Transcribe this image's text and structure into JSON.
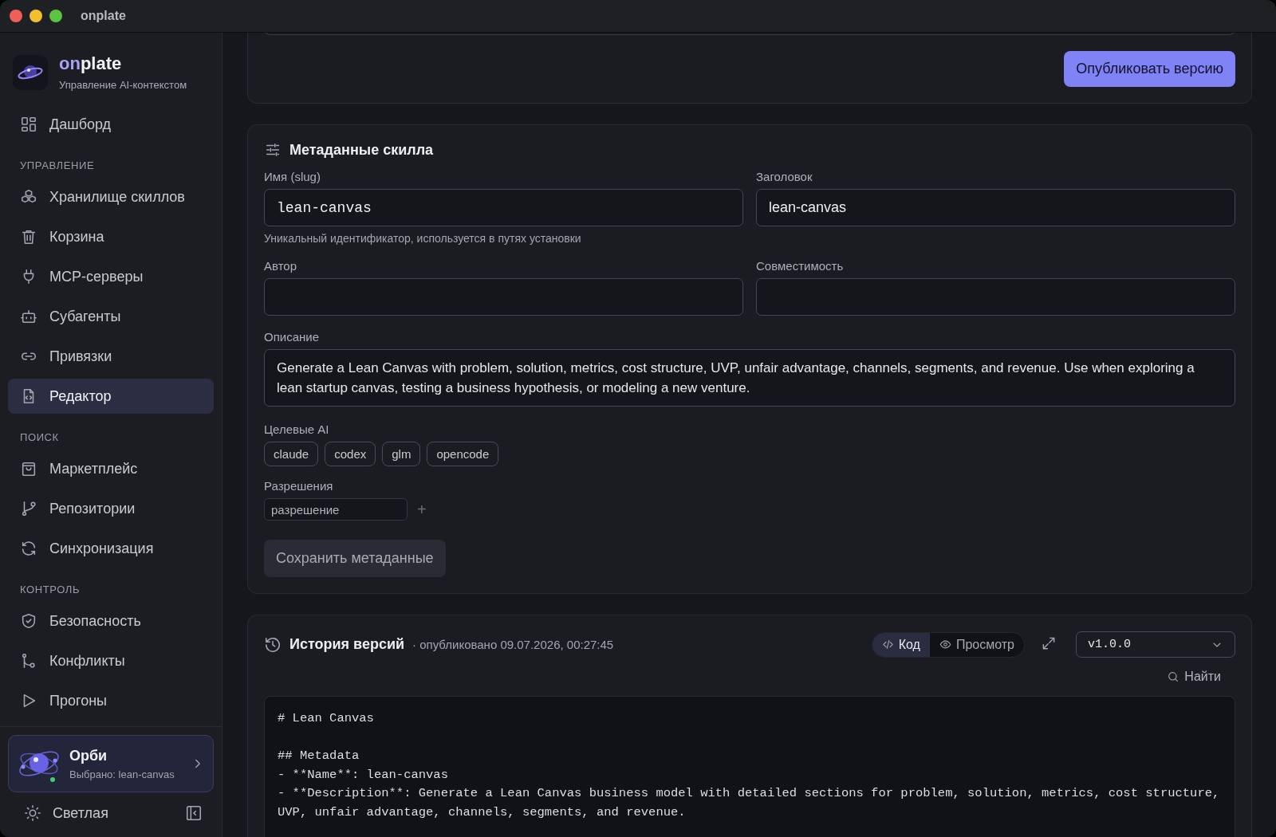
{
  "window": {
    "title": "onplate"
  },
  "brand": {
    "name_accent": "on",
    "name_rest": "plate",
    "subtitle": "Управление AI-контекстом"
  },
  "sidebar": {
    "groups": [
      {
        "items": [
          {
            "label": "Дашборд",
            "selected": false
          }
        ]
      },
      {
        "heading": "УПРАВЛЕНИЕ",
        "items": [
          {
            "label": "Хранилище скиллов",
            "selected": false
          },
          {
            "label": "Корзина",
            "selected": false
          },
          {
            "label": "MCP-серверы",
            "selected": false
          },
          {
            "label": "Субагенты",
            "selected": false
          },
          {
            "label": "Привязки",
            "selected": false
          },
          {
            "label": "Редактор",
            "selected": true
          }
        ]
      },
      {
        "heading": "ПОИСК",
        "items": [
          {
            "label": "Маркетплейс",
            "selected": false
          },
          {
            "label": "Репозитории",
            "selected": false
          },
          {
            "label": "Синхронизация",
            "selected": false
          }
        ]
      },
      {
        "heading": "КОНТРОЛЬ",
        "items": [
          {
            "label": "Безопасность",
            "selected": false
          },
          {
            "label": "Конфликты",
            "selected": false
          },
          {
            "label": "Прогоны",
            "selected": false
          }
        ]
      }
    ]
  },
  "assistant": {
    "name": "Орби",
    "subtitle": "Выбрано: lean-canvas",
    "online": true
  },
  "theme_toggle": {
    "label": "Светлая"
  },
  "publish_button": "Опубликовать версию",
  "metadata": {
    "title": "Метаданные скилла",
    "fields": [
      {
        "label": "Имя (slug)",
        "value": "lean-canvas",
        "monospace": true,
        "hint": "Уникальный идентификатор, используется в путях установки"
      },
      {
        "label": "Заголовок",
        "value": "lean-canvas",
        "monospace": false
      },
      {
        "label": "Автор"
      },
      {
        "label": "Совместимость"
      }
    ],
    "description": {
      "label": "Описание",
      "value": "Generate a Lean Canvas with problem, solution, metrics, cost structure, UVP, unfair advantage, channels, segments, and revenue. Use when exploring a lean startup canvas, testing a business hypothesis, or modeling a new venture."
    },
    "targets": {
      "label": "Целевые AI",
      "tags": [
        "claude",
        "codex",
        "glm",
        "opencode"
      ]
    },
    "permissions": {
      "label": "Разрешения",
      "placeholder": "разрешение",
      "add": "+"
    },
    "save_button": {
      "label": "Сохранить метаданные",
      "disabled": true
    }
  },
  "history": {
    "title": "История версий",
    "published": "· опубликовано 09.07.2026, 00:27:45",
    "view_tabs": [
      {
        "label": "Код",
        "selected": true
      },
      {
        "label": "Просмотр",
        "selected": false
      }
    ],
    "version": "v1.0.0",
    "find": "Найти",
    "code_blocks": [
      [
        "# Lean Canvas"
      ],
      [
        "## Metadata",
        "- **Name**: lean-canvas",
        "- **Description**: Generate a Lean Canvas business model with detailed sections for problem, solution, metrics, cost structure, UVP, unfair advantage, channels, segments, and revenue."
      ]
    ]
  }
}
